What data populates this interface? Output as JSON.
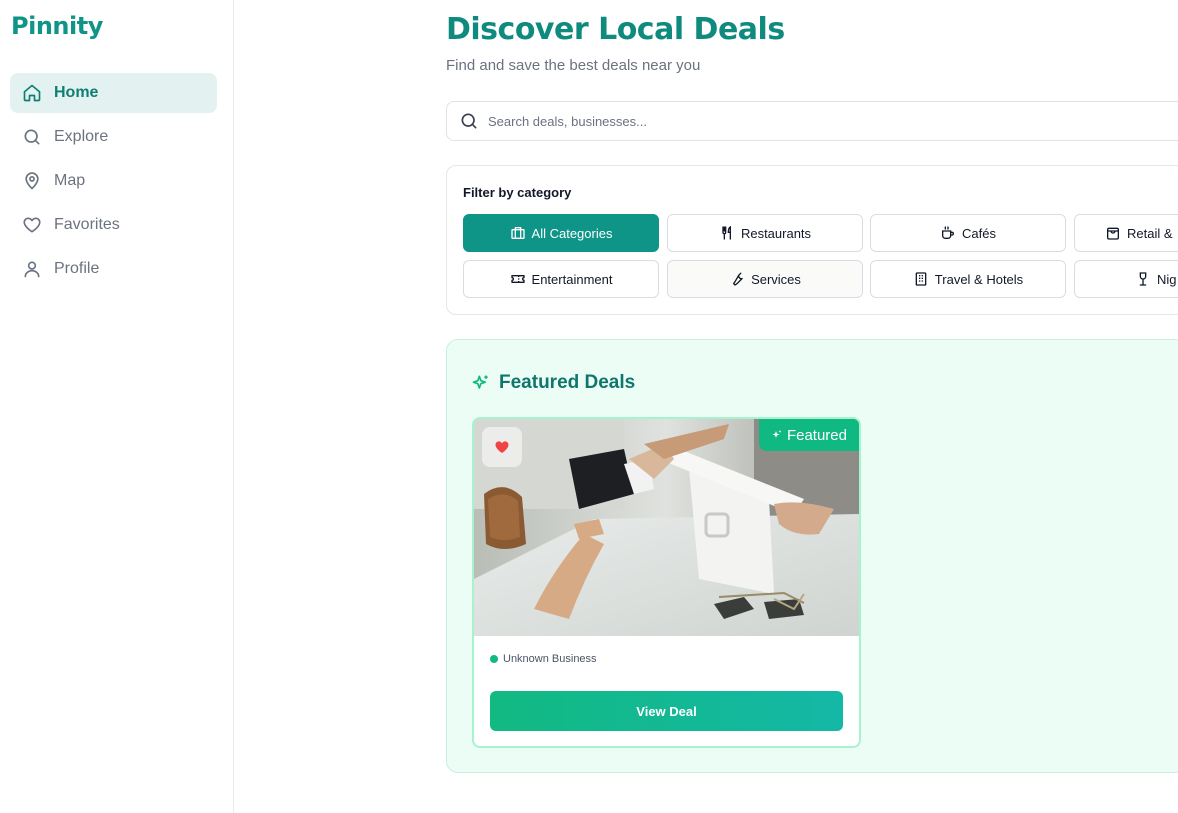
{
  "app": {
    "brand": "Pinnity"
  },
  "sidebar": {
    "items": [
      {
        "label": "Home",
        "icon": "home-icon",
        "active": true
      },
      {
        "label": "Explore",
        "icon": "search-icon",
        "active": false
      },
      {
        "label": "Map",
        "icon": "map-pin-icon",
        "active": false
      },
      {
        "label": "Favorites",
        "icon": "heart-icon",
        "active": false
      },
      {
        "label": "Profile",
        "icon": "user-icon",
        "active": false
      }
    ]
  },
  "header": {
    "title": "Discover Local Deals",
    "subtitle": "Find and save the best deals near you"
  },
  "search": {
    "placeholder": "Search deals, businesses...",
    "value": ""
  },
  "filters": {
    "title": "Filter by category",
    "categories": [
      {
        "label": "All Categories",
        "icon": "store-icon",
        "active": true
      },
      {
        "label": "Restaurants",
        "icon": "utensils-icon",
        "active": false
      },
      {
        "label": "Cafés",
        "icon": "coffee-icon",
        "active": false
      },
      {
        "label": "Retail &",
        "icon": "shopping-bag-icon",
        "active": false
      },
      {
        "label": "Entertainment",
        "icon": "ticket-icon",
        "active": false
      },
      {
        "label": "Services",
        "icon": "wrench-icon",
        "active": false
      },
      {
        "label": "Travel & Hotels",
        "icon": "building-icon",
        "active": false
      },
      {
        "label": "Nig",
        "icon": "wine-glass-icon",
        "active": false
      }
    ]
  },
  "featured": {
    "title": "Featured Deals",
    "deal": {
      "badge": "Featured",
      "business": "Unknown Business",
      "button": "View Deal"
    }
  },
  "colors": {
    "primary": "#0f9488",
    "accent": "#10b981",
    "favorite": "#ef4444",
    "featured_bg": "#ecfdf5"
  }
}
